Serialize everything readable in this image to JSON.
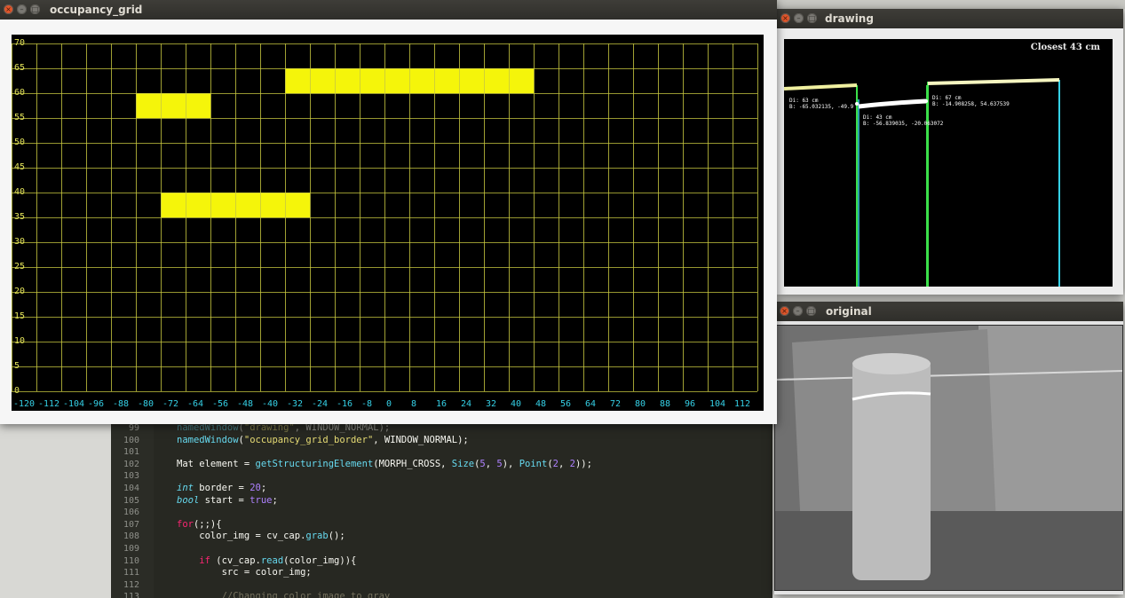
{
  "windows": {
    "occupancy_grid": {
      "title": "occupancy_grid",
      "y_ticks": [
        "70",
        "65",
        "60",
        "55",
        "50",
        "45",
        "40",
        "35",
        "30",
        "25",
        "20",
        "15",
        "10",
        "5",
        "0"
      ],
      "x_ticks": [
        "-120",
        "-112",
        "-104",
        "-96",
        "-88",
        "-80",
        "-72",
        "-64",
        "-56",
        "-48",
        "-40",
        "-32",
        "-24",
        "-16",
        "-8",
        "0",
        "8",
        "16",
        "24",
        "32",
        "40",
        "48",
        "56",
        "64",
        "72",
        "80",
        "88",
        "96",
        "104",
        "112"
      ],
      "grid_color": "#c8c840",
      "fill_color": "#f5f50a",
      "occupied_blocks": [
        {
          "x_from": -32,
          "x_to": 48,
          "y_from": 60,
          "y_to": 65
        },
        {
          "x_from": -80,
          "x_to": -56,
          "y_from": 55,
          "y_to": 60
        },
        {
          "x_from": -72,
          "x_to": -24,
          "y_from": 35,
          "y_to": 40
        }
      ]
    },
    "drawing": {
      "title": "drawing",
      "closest_label": "Closest 43 cm",
      "objects": [
        {
          "line1": "Di: 63 cm",
          "line2": "B: -65.032135, -49.9"
        },
        {
          "line1": "Di: 43 cm",
          "line2": "B: -56.839035, -20.063072"
        },
        {
          "line1": "Di: 67 cm",
          "line2": "B: -14.908258, 54.637539"
        }
      ]
    },
    "original": {
      "title": "original"
    }
  },
  "editor": {
    "lines": [
      {
        "n": "99",
        "code": "namedWindow(\"drawing\", WINDOW_NORMAL);"
      },
      {
        "n": "100",
        "code": "namedWindow(\"occupancy_grid_border\", WINDOW_NORMAL);"
      },
      {
        "n": "101",
        "code": ""
      },
      {
        "n": "102",
        "code": "Mat element = getStructuringElement(MORPH_CROSS, Size(5, 5), Point(2, 2));"
      },
      {
        "n": "103",
        "code": ""
      },
      {
        "n": "104",
        "code": "int border = 20;"
      },
      {
        "n": "105",
        "code": "bool start = true;"
      },
      {
        "n": "106",
        "code": ""
      },
      {
        "n": "107",
        "code": "for(;;){"
      },
      {
        "n": "108",
        "code": "    color_img = cv_cap.grab();"
      },
      {
        "n": "109",
        "code": ""
      },
      {
        "n": "110",
        "code": "    if (cv_cap.read(color_img)){"
      },
      {
        "n": "111",
        "code": "        src = color_img;"
      },
      {
        "n": "112",
        "code": ""
      },
      {
        "n": "113",
        "code": "        //Changing color image to gray"
      }
    ]
  }
}
